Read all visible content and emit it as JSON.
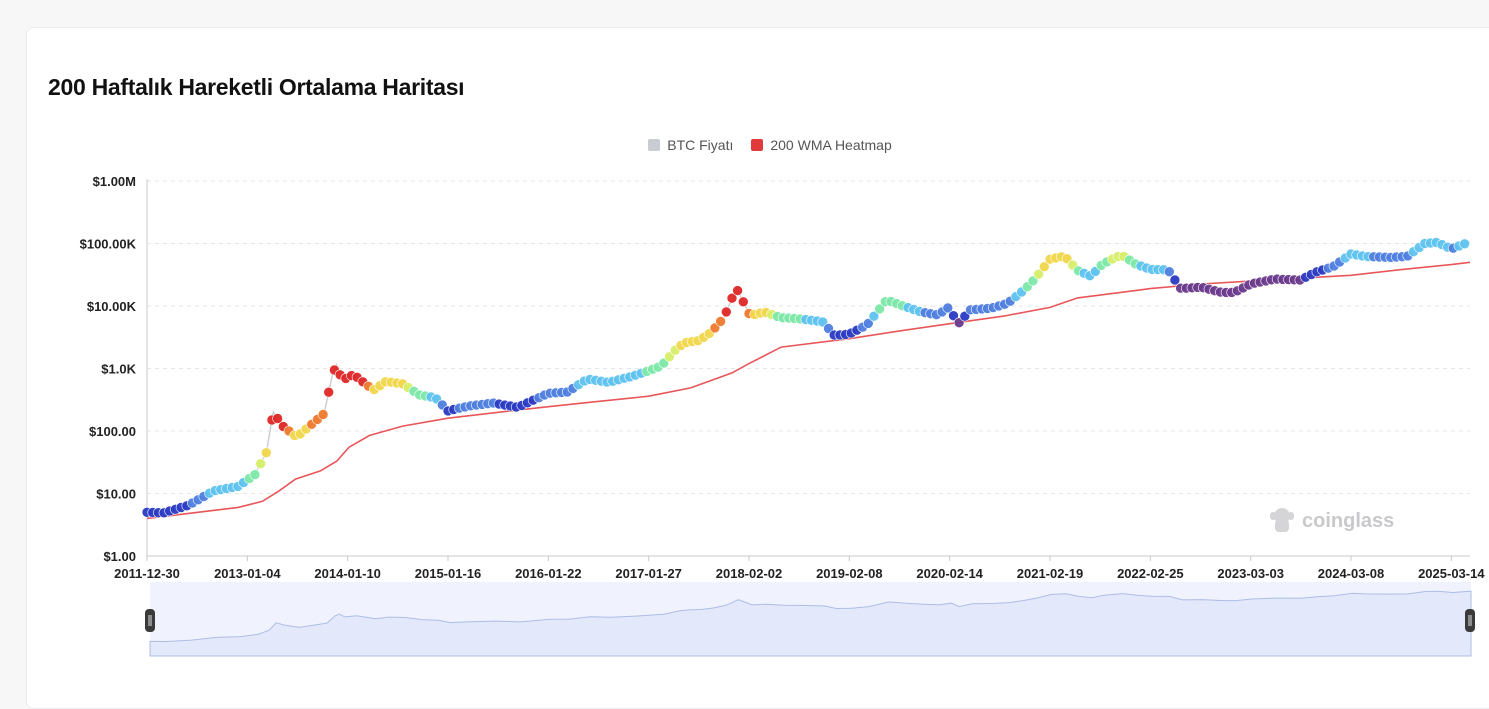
{
  "title": "200 Haftalık Hareketli Ortalama Haritası",
  "watermark": "coinglass",
  "colors": {
    "price_line": "#c9ccd3",
    "wma_line": "#e8565a",
    "grid": "#e6e6ea",
    "navigator_fill": "#e3e9fb",
    "navigator_line": "#aebde6",
    "heat_scale": [
      "#2b3bc4",
      "#4f7fe0",
      "#5ec3f0",
      "#7de8a8",
      "#d8ef6a",
      "#f2d84c",
      "#f07a2e",
      "#e02828"
    ],
    "low_heat": "#6b3a8c"
  },
  "chart_data": {
    "type": "line",
    "title": "200 Haftalık Hareketli Ortalama Haritası",
    "yscale": "log",
    "ylim": [
      1,
      1000000
    ],
    "ytick_labels": [
      "$1.00",
      "$10.00",
      "$100.00",
      "$1.0K",
      "$10.00K",
      "$100.00K",
      "$1.00M"
    ],
    "xtick_labels": [
      "2011-12-30",
      "2013-01-04",
      "2014-01-10",
      "2015-01-16",
      "2016-01-22",
      "2017-01-27",
      "2018-02-02",
      "2019-02-08",
      "2020-02-14",
      "2021-02-19",
      "2022-02-25",
      "2023-03-03",
      "2024-03-08",
      "2025-03-14"
    ],
    "grid": true,
    "legend_position": "top-center",
    "series": [
      {
        "name": "BTC Fiyatı",
        "color": "#c9ccd3",
        "x": [
          "2011-12-30",
          "2012-03-01",
          "2012-06-01",
          "2012-09-01",
          "2012-12-01",
          "2013-02-01",
          "2013-03-15",
          "2013-04-10",
          "2013-05-15",
          "2013-07-05",
          "2013-09-01",
          "2013-10-15",
          "2013-11-15",
          "2013-11-30",
          "2013-12-20",
          "2014-02-01",
          "2014-04-15",
          "2014-06-01",
          "2014-08-01",
          "2014-10-01",
          "2014-12-01",
          "2015-01-16",
          "2015-04-01",
          "2015-07-01",
          "2015-10-01",
          "2016-01-22",
          "2016-04-01",
          "2016-06-15",
          "2016-09-01",
          "2016-12-01",
          "2017-01-27",
          "2017-03-15",
          "2017-05-15",
          "2017-06-15",
          "2017-08-01",
          "2017-09-15",
          "2017-11-01",
          "2017-12-17",
          "2018-01-15",
          "2018-02-06",
          "2018-04-01",
          "2018-06-01",
          "2018-08-01",
          "2018-11-01",
          "2018-12-15",
          "2019-02-08",
          "2019-04-15",
          "2019-06-26",
          "2019-09-01",
          "2019-11-01",
          "2020-01-01",
          "2020-02-14",
          "2020-03-13",
          "2020-05-01",
          "2020-07-15",
          "2020-09-15",
          "2020-11-15",
          "2020-12-31",
          "2021-02-19",
          "2021-04-14",
          "2021-06-01",
          "2021-07-20",
          "2021-09-01",
          "2021-11-10",
          "2022-01-01",
          "2022-02-25",
          "2022-05-01",
          "2022-06-18",
          "2022-09-01",
          "2022-11-15",
          "2023-01-01",
          "2023-03-03",
          "2023-06-01",
          "2023-09-01",
          "2023-11-01",
          "2024-01-01",
          "2024-03-08",
          "2024-05-01",
          "2024-08-01",
          "2024-10-01",
          "2024-12-05",
          "2025-01-20",
          "2025-03-14",
          "2025-05-22"
        ],
        "y": [
          5.0,
          4.9,
          6.5,
          11,
          13,
          20,
          45,
          200,
          120,
          80,
          130,
          190,
          800,
          1150,
          650,
          800,
          450,
          620,
          570,
          380,
          340,
          210,
          250,
          280,
          240,
          400,
          420,
          680,
          600,
          760,
          920,
          1100,
          2200,
          2600,
          2800,
          3800,
          6500,
          19500,
          11000,
          7000,
          8000,
          6500,
          6300,
          5600,
          3400,
          3550,
          5000,
          12500,
          9800,
          8000,
          7200,
          9800,
          5000,
          8700,
          9200,
          11000,
          18000,
          29000,
          56000,
          63000,
          37000,
          30000,
          47000,
          66000,
          47000,
          38500,
          38000,
          19000,
          20000,
          16500,
          16500,
          22500,
          27000,
          26000,
          35000,
          42500,
          68000,
          62000,
          60000,
          62000,
          100000,
          104000,
          82000,
          107000
        ]
      },
      {
        "name": "200 WMA Heatmap",
        "color": "#e8565a",
        "x": [
          "2011-12-30",
          "2012-06-01",
          "2012-12-01",
          "2013-03-01",
          "2013-05-01",
          "2013-07-01",
          "2013-10-01",
          "2013-12-01",
          "2014-01-15",
          "2014-04-01",
          "2014-08-01",
          "2015-01-16",
          "2015-07-01",
          "2016-01-22",
          "2016-07-01",
          "2017-01-27",
          "2017-07-01",
          "2017-12-01",
          "2018-02-02",
          "2018-06-01",
          "2019-02-08",
          "2019-09-01",
          "2020-02-14",
          "2020-09-01",
          "2021-02-19",
          "2021-06-01",
          "2022-02-25",
          "2022-09-01",
          "2023-03-03",
          "2023-09-01",
          "2024-03-08",
          "2024-09-01",
          "2025-03-14",
          "2025-05-22"
        ],
        "y": [
          4.0,
          4.8,
          6.0,
          7.5,
          11,
          17,
          23,
          33,
          55,
          85,
          120,
          160,
          195,
          245,
          290,
          360,
          490,
          850,
          1200,
          2200,
          3000,
          4100,
          5200,
          6900,
          9500,
          13500,
          19000,
          22500,
          25000,
          27800,
          31000,
          38000,
          46000,
          50000
        ]
      }
    ]
  }
}
